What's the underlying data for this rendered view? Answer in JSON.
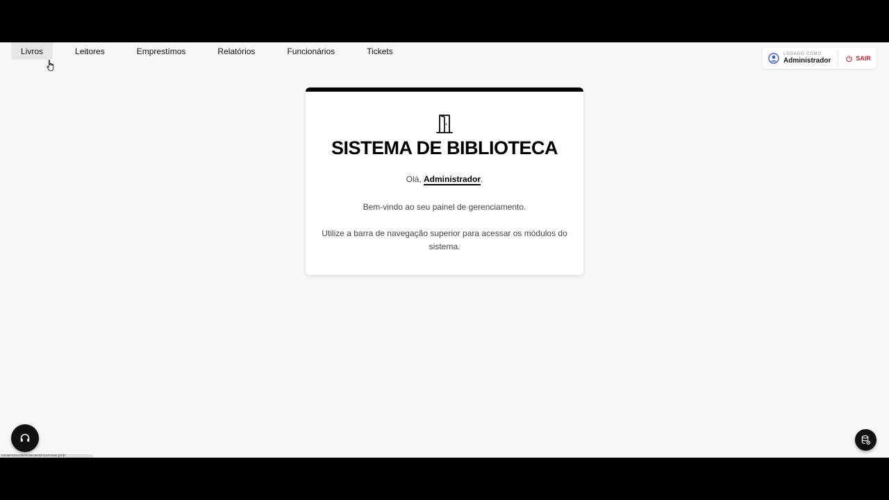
{
  "nav": {
    "items": [
      {
        "label": "Livros",
        "active": true
      },
      {
        "label": "Leitores",
        "active": false
      },
      {
        "label": "Emprestímos",
        "active": false
      },
      {
        "label": "Relatórios",
        "active": false
      },
      {
        "label": "Funcionários",
        "active": false
      },
      {
        "label": "Tickets",
        "active": false
      }
    ]
  },
  "user": {
    "caption": "LOGADO COMO",
    "name": "Administrador",
    "logout_label": "SAIR",
    "avatar_icon": "user-circle-icon",
    "logout_icon": "power-icon"
  },
  "card": {
    "icon": "door-icon",
    "title": "SISTEMA DE BIBLIOTECA",
    "greeting_prefix": "Olá, ",
    "greeting_name": "Administrador",
    "greeting_suffix": ".",
    "welcome": "Bem-vindo ao seu painel de gerenciamento.",
    "instructions": "Utilize a barra de navegação superior para acessar os módulos do sistema."
  },
  "floating": {
    "support_icon": "headset-icon",
    "db_icon": "database-settings-icon"
  },
  "status_bar": {
    "url": "localhost/biblioteca/livros/listar.php"
  },
  "colors": {
    "background": "#f5f8f7",
    "accent_bar": "#000000",
    "logout": "#c0283a"
  }
}
